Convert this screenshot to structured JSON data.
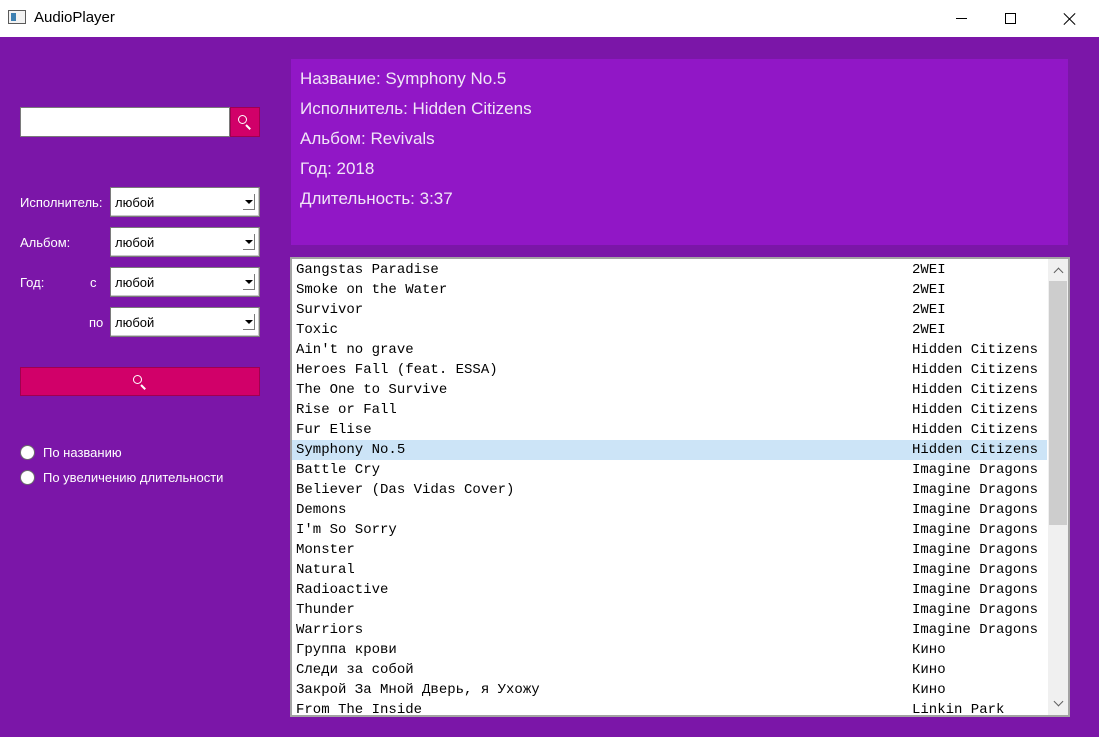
{
  "window": {
    "title": "AudioPlayer"
  },
  "filters": {
    "search_value": "",
    "artist_label": "Исполнитель:",
    "artist_value": "любой",
    "album_label": "Альбом:",
    "album_value": "любой",
    "year_label": "Год:",
    "year_from_label": "с",
    "year_from_value": "любой",
    "year_to_label": "по",
    "year_to_value": "любой"
  },
  "sort": {
    "options": [
      "По названию",
      "По увеличению длительности"
    ]
  },
  "track_info": {
    "title_line": "Название: Symphony No.5",
    "artist_line": "Исполнитель: Hidden Citizens",
    "album_line": "Альбом: Revivals",
    "year_line": "Год: 2018",
    "duration_line": "Длительность: 3:37"
  },
  "tracks": [
    {
      "title": "Gangstas Paradise",
      "artist": "2WEI"
    },
    {
      "title": "Smoke on the Water",
      "artist": "2WEI"
    },
    {
      "title": "Survivor",
      "artist": "2WEI"
    },
    {
      "title": "Toxic",
      "artist": "2WEI"
    },
    {
      "title": "Ain't no grave",
      "artist": "Hidden Citizens"
    },
    {
      "title": "Heroes Fall (feat. ESSA)",
      "artist": "Hidden Citizens"
    },
    {
      "title": "The One to Survive",
      "artist": "Hidden Citizens"
    },
    {
      "title": "Rise or Fall",
      "artist": "Hidden Citizens"
    },
    {
      "title": "Fur Elise",
      "artist": "Hidden Citizens"
    },
    {
      "title": "Symphony No.5",
      "artist": "Hidden Citizens"
    },
    {
      "title": "Battle Cry",
      "artist": "Imagine Dragons"
    },
    {
      "title": "Believer (Das Vidas Cover)",
      "artist": "Imagine Dragons"
    },
    {
      "title": "Demons",
      "artist": "Imagine Dragons"
    },
    {
      "title": "I'm So Sorry",
      "artist": "Imagine Dragons"
    },
    {
      "title": "Monster",
      "artist": "Imagine Dragons"
    },
    {
      "title": "Natural",
      "artist": "Imagine Dragons"
    },
    {
      "title": "Radioactive",
      "artist": "Imagine Dragons"
    },
    {
      "title": "Thunder",
      "artist": "Imagine Dragons"
    },
    {
      "title": "Warriors",
      "artist": "Imagine Dragons"
    },
    {
      "title": "Группа крови",
      "artist": "Кино"
    },
    {
      "title": "Следи за собой",
      "artist": "Кино"
    },
    {
      "title": "Закрой За Мной Дверь, я Ухожу",
      "artist": "Кино"
    },
    {
      "title": "From The Inside",
      "artist": "Linkin Park"
    }
  ],
  "selected_track_index": 9,
  "colors": {
    "background": "#7b16a8",
    "info_panel": "#9117c6",
    "accent_button": "#d10069",
    "selection": "#cce4f7"
  },
  "icons": {
    "search": "magnifier-icon"
  }
}
